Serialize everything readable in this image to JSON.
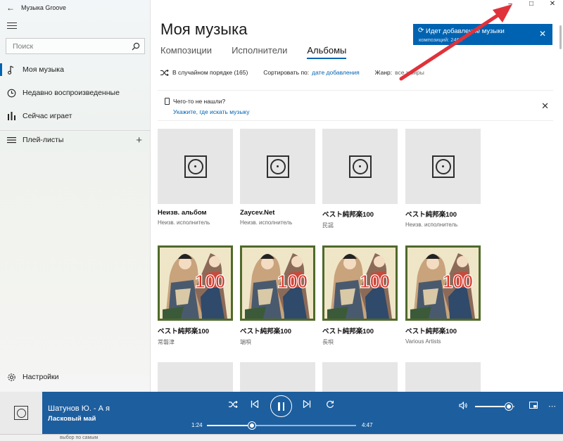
{
  "app": {
    "title": "Музыка Groove"
  },
  "sidebar": {
    "search_placeholder": "Поиск",
    "items": [
      {
        "label": "Моя музыка",
        "icon": "music-note-icon",
        "active": true
      },
      {
        "label": "Недавно воспроизведенные",
        "icon": "clock-icon",
        "active": false
      },
      {
        "label": "Сейчас играет",
        "icon": "bars-chart-icon",
        "active": false
      },
      {
        "label": "Плей-листы",
        "icon": "list-icon",
        "active": false
      }
    ],
    "settings_label": "Настройки"
  },
  "main": {
    "title": "Моя музыка",
    "tabs": [
      {
        "label": "Композиции",
        "selected": false
      },
      {
        "label": "Исполнители",
        "selected": false
      },
      {
        "label": "Альбомы",
        "selected": true
      }
    ],
    "toolbar": {
      "shuffle_label": "В случайном порядке (165)",
      "sort_label": "Сортировать по:",
      "sort_value": "дате добавления",
      "genre_label": "Жанр:",
      "genre_value": "все жанры"
    },
    "infobar": {
      "question": "Чего-то не нашли?",
      "link": "Укажите, где искать музыку"
    },
    "albums": [
      {
        "name": "Неизв. альбом",
        "artist": "Неизв. исполнитель",
        "art": "placeholder"
      },
      {
        "name": "Zaycev.Net",
        "artist": "Неизв. исполнитель",
        "art": "placeholder"
      },
      {
        "name": "ベスト純邦楽100",
        "artist": "民謡",
        "art": "placeholder"
      },
      {
        "name": "ベスト純邦楽100",
        "artist": "Неизв. исполнитель",
        "art": "placeholder"
      },
      {
        "name": "ベスト純邦楽100",
        "artist": "常磐津",
        "art": "ukiyo-e"
      },
      {
        "name": "ベスト純邦楽100",
        "artist": "端唄",
        "art": "ukiyo-e"
      },
      {
        "name": "ベスト純邦楽100",
        "artist": "長唄",
        "art": "ukiyo-e"
      },
      {
        "name": "ベスト純邦楽100",
        "artist": "Various Artists",
        "art": "ukiyo-e"
      }
    ],
    "cover_badge_text": "100"
  },
  "toast": {
    "title": "Идет добавление музыки",
    "subtitle": "композиций: 2460"
  },
  "player": {
    "song": "Шатунов Ю. - А я",
    "artist": "Ласковый май",
    "elapsed": "1:24",
    "duration": "4:47",
    "progress": 0.3,
    "volume": 0.85
  },
  "taskbar_text": "выбор по самым",
  "colors": {
    "accent": "#0063b1",
    "player_bg": "#1d5e9e",
    "arrow": "#e0323a"
  }
}
